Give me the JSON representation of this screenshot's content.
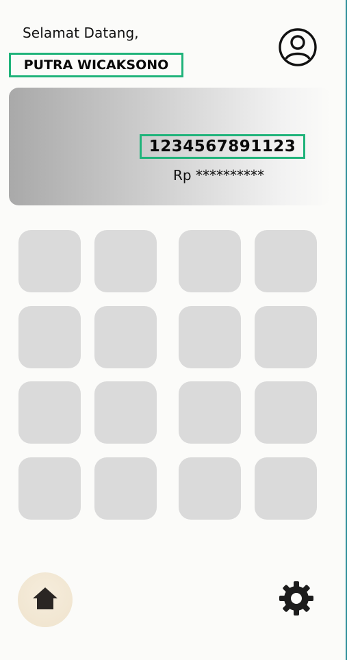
{
  "header": {
    "greeting": "Selamat Datang,",
    "username": "PUTRA WICAKSONO"
  },
  "card": {
    "account_number": "1234567891123",
    "balance": "Rp **********"
  },
  "menu_grid": {
    "tiles": [
      "",
      "",
      "",
      "",
      "",
      "",
      "",
      "",
      "",
      "",
      "",
      "",
      "",
      "",
      "",
      ""
    ]
  },
  "bottom_nav": {
    "home_icon": "home-icon",
    "settings_icon": "gear-icon"
  },
  "colors": {
    "highlight": "#1fb37a",
    "tile": "#dadada",
    "home_bg": "#efe3cd"
  }
}
